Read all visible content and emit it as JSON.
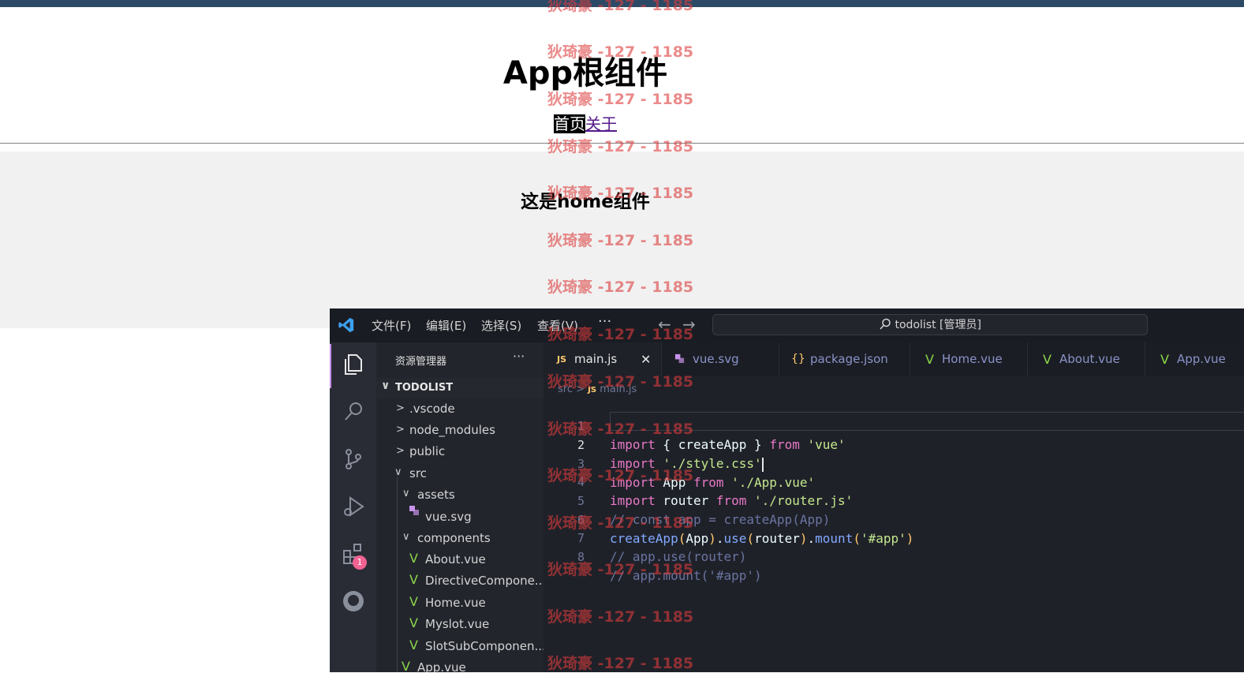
{
  "browser": {
    "app_title": "App根组件",
    "nav": {
      "home": "首页",
      "about": "关于"
    },
    "home_content": "这是home组件"
  },
  "vscode": {
    "menu": [
      "文件(F)",
      "编辑(E)",
      "选择(S)",
      "查看(V)"
    ],
    "more": "···",
    "back_arrow": "←",
    "forward_arrow": "→",
    "search_text": "todolist [管理员]",
    "sidebar": {
      "header": "资源管理器",
      "dots": "···",
      "project": "TODOLIST",
      "items": [
        {
          "label": ".vscode",
          "type": "folder-collapsed"
        },
        {
          "label": "node_modules",
          "type": "folder-collapsed"
        },
        {
          "label": "public",
          "type": "folder-collapsed"
        },
        {
          "label": "src",
          "type": "folder-open"
        },
        {
          "label": "assets",
          "type": "folder-open"
        },
        {
          "label": "vue.svg",
          "type": "svg-file"
        },
        {
          "label": "components",
          "type": "folder-open"
        },
        {
          "label": "About.vue",
          "type": "vue-file"
        },
        {
          "label": "DirectiveCompone...",
          "type": "vue-file"
        },
        {
          "label": "Home.vue",
          "type": "vue-file"
        },
        {
          "label": "Myslot.vue",
          "type": "vue-file"
        },
        {
          "label": "SlotSubComponen...",
          "type": "vue-file"
        },
        {
          "label": "App.vue",
          "type": "vue-file"
        }
      ]
    },
    "extensions_badge": "1",
    "tabs": [
      {
        "label": "main.js",
        "icon": "JS",
        "active": true
      },
      {
        "label": "vue.svg",
        "icon": "svg-icon"
      },
      {
        "label": "package.json",
        "icon": "{}"
      },
      {
        "label": "Home.vue",
        "icon": "vue-icon"
      },
      {
        "label": "About.vue",
        "icon": "vue-icon"
      },
      {
        "label": "App.vue",
        "icon": "vue-icon"
      }
    ],
    "breadcrumb": {
      "folder": "src",
      "sep": ">",
      "icon": "JS",
      "file": "main.js"
    },
    "code_lines": [
      {
        "n": "1",
        "text": "import { createApp } from 'vue'"
      },
      {
        "n": "2",
        "text": "import './style.css'"
      },
      {
        "n": "3",
        "text": "import App from './App.vue'"
      },
      {
        "n": "4",
        "text": "import router from './router.js'"
      },
      {
        "n": "5",
        "text": "// const app = createApp(App)"
      },
      {
        "n": "6",
        "text": "createApp(App).use(router).mount('#app')"
      },
      {
        "n": "7",
        "text": "// app.use(router)"
      },
      {
        "n": "8",
        "text": "// app.mount('#app')"
      }
    ]
  },
  "watermark": "狄琦豪 -127 - 1185",
  "colors": {
    "topbar": "#2c4a66",
    "editor_bg": "#1f2129",
    "keyword": "#e879c6",
    "string": "#c3e88d",
    "function": "#82aaff",
    "comment": "#6a74a0",
    "vue_green": "#8bd649",
    "watermark": "#dc3c3c"
  }
}
